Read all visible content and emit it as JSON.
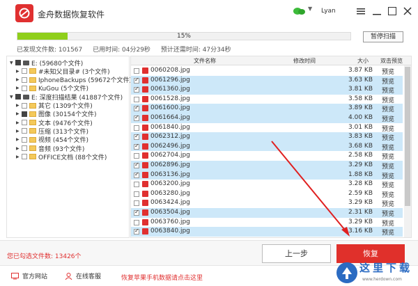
{
  "app": {
    "title": "金舟数据恢复软件",
    "user": "Lyan"
  },
  "progress": {
    "percent_text": "15%",
    "fraction": 0.15,
    "pause_label": "暂停扫描"
  },
  "stats": {
    "found": "已发现文件数: 101567",
    "elapsed": "已用时间: 04分29秒",
    "remaining": "预计还需时间: 47分34秒"
  },
  "tree": [
    {
      "label": "E:  (59680个文件)",
      "type": "drive",
      "expander": "▼",
      "cb": "partial"
    },
    {
      "label": "#未知父目录#  (3个文件)",
      "type": "folder",
      "expander": "▶",
      "cb": "none"
    },
    {
      "label": "IphoneBackups  (59672个文件)",
      "type": "folder",
      "expander": "▶",
      "cb": "none"
    },
    {
      "label": "KuGou  (5个文件)",
      "type": "folder",
      "expander": "▶",
      "cb": "none"
    },
    {
      "label": "E: 深度扫描结果  (41887个文件)",
      "type": "drive",
      "expander": "▼",
      "cb": "partial"
    },
    {
      "label": "其它  (1309个文件)",
      "type": "folder",
      "expander": "▶",
      "cb": "none"
    },
    {
      "label": "图像  (30154个文件)",
      "type": "folder",
      "expander": "▶",
      "cb": "partial"
    },
    {
      "label": "文本  (9476个文件)",
      "type": "folder",
      "expander": "▶",
      "cb": "none"
    },
    {
      "label": "压缩  (313个文件)",
      "type": "folder",
      "expander": "▶",
      "cb": "none"
    },
    {
      "label": "视频  (454个文件)",
      "type": "folder",
      "expander": "▶",
      "cb": "none"
    },
    {
      "label": "音频  (93个文件)",
      "type": "folder",
      "expander": "▶",
      "cb": "none"
    },
    {
      "label": "OFFICE文档  (88个文件)",
      "type": "folder",
      "expander": "▶",
      "cb": "none"
    }
  ],
  "table": {
    "headers": {
      "name": "文件名称",
      "modified": "修改时间",
      "size": "大小",
      "preview": "双击预览"
    },
    "rows": [
      {
        "name": "0060208.jpg",
        "size": "3.87 KB",
        "checked": false,
        "preview": "预览"
      },
      {
        "name": "0061296.jpg",
        "size": "3.63 KB",
        "checked": true,
        "preview": "预览"
      },
      {
        "name": "0061360.jpg",
        "size": "3.81 KB",
        "checked": true,
        "preview": "预览"
      },
      {
        "name": "0061528.jpg",
        "size": "3.58 KB",
        "checked": false,
        "preview": "预览"
      },
      {
        "name": "0061600.jpg",
        "size": "3.89 KB",
        "checked": true,
        "preview": "预览"
      },
      {
        "name": "0061664.jpg",
        "size": "4.00 KB",
        "checked": true,
        "preview": "预览"
      },
      {
        "name": "0061840.jpg",
        "size": "3.01 KB",
        "checked": false,
        "preview": "预览"
      },
      {
        "name": "0062312.jpg",
        "size": "3.83 KB",
        "checked": true,
        "preview": "预览"
      },
      {
        "name": "0062496.jpg",
        "size": "3.68 KB",
        "checked": true,
        "preview": "预览"
      },
      {
        "name": "0062704.jpg",
        "size": "2.58 KB",
        "checked": false,
        "preview": "预览"
      },
      {
        "name": "0062896.jpg",
        "size": "3.29 KB",
        "checked": true,
        "preview": "预览"
      },
      {
        "name": "0063136.jpg",
        "size": "1.88 KB",
        "checked": true,
        "preview": "预览"
      },
      {
        "name": "0063200.jpg",
        "size": "3.28 KB",
        "checked": false,
        "preview": "预览"
      },
      {
        "name": "0063280.jpg",
        "size": "2.59 KB",
        "checked": false,
        "preview": "预览"
      },
      {
        "name": "0063424.jpg",
        "size": "3.29 KB",
        "checked": false,
        "preview": "预览"
      },
      {
        "name": "0063504.jpg",
        "size": "2.31 KB",
        "checked": true,
        "preview": "预览"
      },
      {
        "name": "0063760.jpg",
        "size": "3.29 KB",
        "checked": false,
        "preview": "预览"
      },
      {
        "name": "0063840.jpg",
        "size": "3.16 KB",
        "checked": true,
        "preview": "预览"
      }
    ]
  },
  "bottom": {
    "selected_count": "您已勾选文件数: 13426个",
    "prev_label": "上一步",
    "recover_label": "恢复"
  },
  "footer": {
    "website": "官方网站",
    "service": "在线客服",
    "promo": "恢复苹果手机数据请点击这里"
  },
  "watermark": {
    "text": "这里下载",
    "sub": "www.herdown.com"
  },
  "colors": {
    "accent": "#e03030",
    "progress": "#8fcf1b",
    "selected_row": "#cde8f9"
  }
}
